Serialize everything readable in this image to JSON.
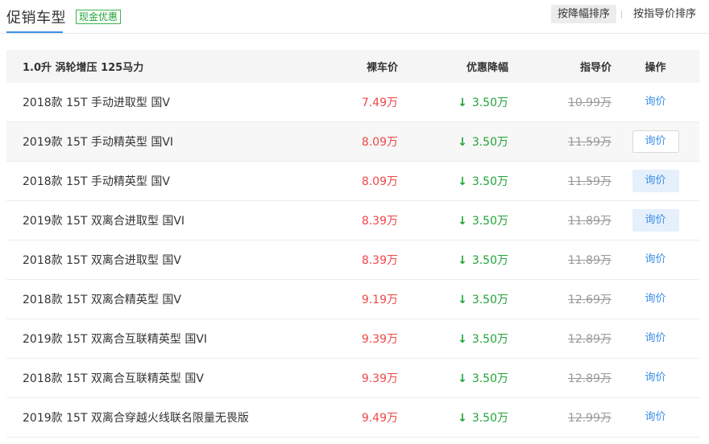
{
  "header": {
    "title": "促销车型",
    "badge": "现金优惠",
    "sort_options": [
      "按降幅排序",
      "按指导价排序"
    ]
  },
  "table": {
    "columns": {
      "name": "1.0升 涡轮增压 125马力",
      "price": "裸车价",
      "discount": "优惠降幅",
      "guide": "指导价",
      "action": "操作"
    },
    "rows": [
      {
        "name": "2018款 15T 手动进取型 国V",
        "price": "7.49万",
        "discount": "3.50万",
        "guide": "10.99万",
        "action": "询价"
      },
      {
        "name": "2019款 15T 手动精英型 国VI",
        "price": "8.09万",
        "discount": "3.50万",
        "guide": "11.59万",
        "action": "询价"
      },
      {
        "name": "2018款 15T 手动精英型 国V",
        "price": "8.09万",
        "discount": "3.50万",
        "guide": "11.59万",
        "action": "询价"
      },
      {
        "name": "2019款 15T 双离合进取型 国VI",
        "price": "8.39万",
        "discount": "3.50万",
        "guide": "11.89万",
        "action": "询价"
      },
      {
        "name": "2018款 15T 双离合进取型 国V",
        "price": "8.39万",
        "discount": "3.50万",
        "guide": "11.89万",
        "action": "询价"
      },
      {
        "name": "2018款 15T 双离合精英型 国V",
        "price": "9.19万",
        "discount": "3.50万",
        "guide": "12.69万",
        "action": "询价"
      },
      {
        "name": "2019款 15T 双离合互联精英型 国VI",
        "price": "9.39万",
        "discount": "3.50万",
        "guide": "12.89万",
        "action": "询价"
      },
      {
        "name": "2018款 15T 双离合互联精英型 国V",
        "price": "9.39万",
        "discount": "3.50万",
        "guide": "12.89万",
        "action": "询价"
      },
      {
        "name": "2019款 15T 双离合穿越火线联名限量无畏版",
        "price": "9.49万",
        "discount": "3.50万",
        "guide": "12.99万",
        "action": "询价"
      }
    ]
  },
  "icons": {
    "discount_arrow": "↓"
  },
  "colors": {
    "price": "#f04747",
    "discount": "#22a33a",
    "link": "#3a8ee6"
  }
}
